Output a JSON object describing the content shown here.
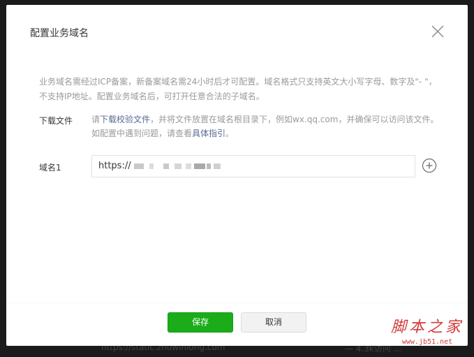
{
  "dialog": {
    "title": "配置业务域名",
    "description": "业务域名需经过ICP备案，新备案域名需24小时后才可配置。域名格式只支持英文大小写字母、数字及\"- \"，不支持IP地址。配置业务域名后，可打开任意合法的子域名。",
    "download": {
      "label": "下载文件",
      "text_prefix": "请",
      "link_download": "下载校验文件",
      "text_middle": "，并将文件放置在域名根目录下，例如wx.qq.com，并确保可以访问该文件。如配置中遇到问题，请查看",
      "link_guide": "具体指引",
      "text_suffix": "。"
    },
    "domain": {
      "label": "域名1",
      "value_prefix": "https://"
    },
    "buttons": {
      "save": "保存",
      "cancel": "取消"
    }
  },
  "background_hint": {
    "left": "https://static.zhuwinlong.com",
    "right": "— 4.3k访问 ..."
  },
  "watermark": {
    "title": "脚本之家",
    "url": "www.jb51.net"
  },
  "colors": {
    "primary_green": "#1aad19",
    "link_blue": "#576b95",
    "watermark_red": "#d33a3a"
  },
  "icons": {
    "close": "close-icon",
    "add": "plus-circle-icon"
  }
}
